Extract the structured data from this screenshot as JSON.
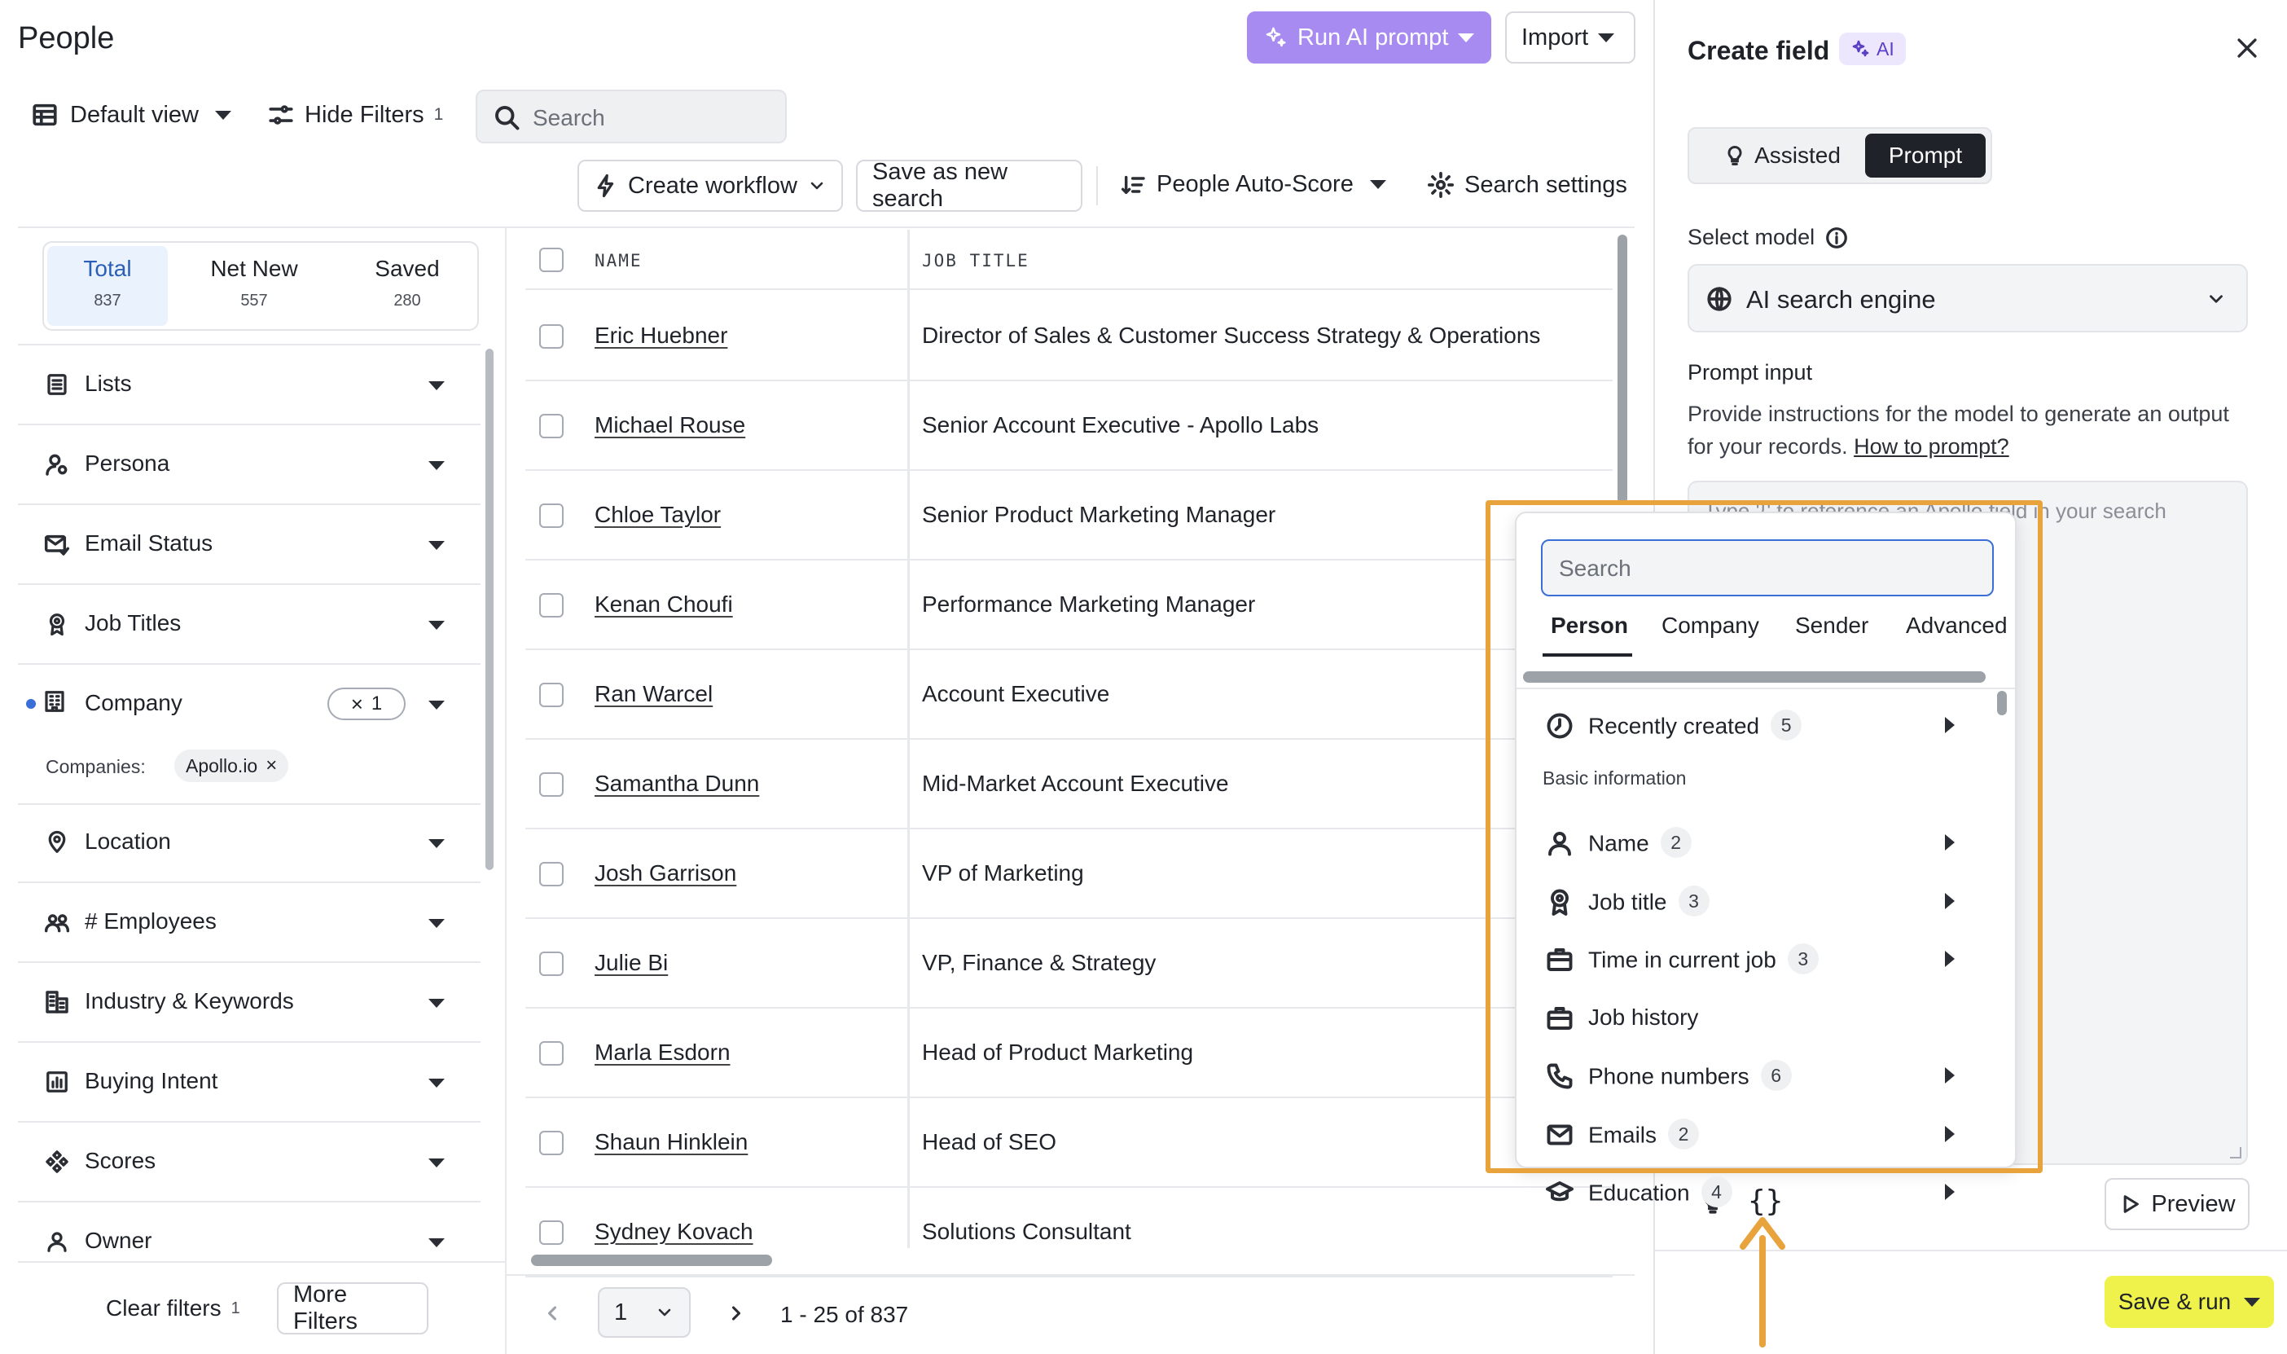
{
  "header": {
    "title": "People",
    "run_ai_label": "Run AI prompt",
    "import_label": "Import"
  },
  "toolbar": {
    "view_label": "Default view",
    "hide_filters_label": "Hide Filters",
    "hide_filters_count": "1",
    "search_placeholder": "Search",
    "create_workflow_label": "Create workflow",
    "save_search_label": "Save as new search",
    "autoscore_label": "People Auto-Score",
    "search_settings_label": "Search settings"
  },
  "stats": [
    {
      "label": "Total",
      "value": "837"
    },
    {
      "label": "Net New",
      "value": "557"
    },
    {
      "label": "Saved",
      "value": "280"
    }
  ],
  "filters": {
    "items": [
      {
        "label": "Lists",
        "icon": "list-icon"
      },
      {
        "label": "Persona",
        "icon": "persona-icon"
      },
      {
        "label": "Email Status",
        "icon": "email-status-icon"
      },
      {
        "label": "Job Titles",
        "icon": "badge-icon"
      },
      {
        "label": "Company",
        "icon": "building-icon"
      },
      {
        "label": "Location",
        "icon": "location-pin-icon"
      },
      {
        "label": "# Employees",
        "icon": "people-icon"
      },
      {
        "label": "Industry & Keywords",
        "icon": "industry-icon"
      },
      {
        "label": "Buying Intent",
        "icon": "bar-chart-icon"
      },
      {
        "label": "Scores",
        "icon": "scores-icon"
      },
      {
        "label": "Owner",
        "icon": "user-icon"
      }
    ],
    "company_count": "1",
    "companies_label": "Companies:",
    "company_chip": "Apollo.io",
    "clear_filters_label": "Clear filters",
    "clear_filters_count": "1",
    "more_filters_label": "More Filters"
  },
  "table": {
    "columns": [
      "NAME",
      "JOB TITLE"
    ],
    "rows": [
      {
        "name": "Eric Huebner",
        "job": "Director of Sales & Customer Success Strategy & Operations"
      },
      {
        "name": "Michael Rouse",
        "job": "Senior Account Executive - Apollo Labs"
      },
      {
        "name": "Chloe Taylor",
        "job": "Senior Product Marketing Manager"
      },
      {
        "name": "Kenan Choufi",
        "job": "Performance Marketing Manager"
      },
      {
        "name": "Ran Warcel",
        "job": "Account Executive"
      },
      {
        "name": "Samantha Dunn",
        "job": "Mid-Market Account Executive"
      },
      {
        "name": "Josh Garrison",
        "job": "VP of Marketing"
      },
      {
        "name": "Julie Bi",
        "job": "VP, Finance & Strategy"
      },
      {
        "name": "Marla Esdorn",
        "job": "Head of Product Marketing"
      },
      {
        "name": "Shaun Hinklein",
        "job": "Head of SEO"
      },
      {
        "name": "Sydney Kovach",
        "job": "Solutions Consultant"
      }
    ]
  },
  "pagination": {
    "page": "1",
    "range": "1 - 25 of 837"
  },
  "panel": {
    "title": "Create field",
    "ai_badge": "AI",
    "tabs": [
      "Assisted",
      "Prompt"
    ],
    "select_model_label": "Select model",
    "model_value": "AI search engine",
    "prompt_input_label": "Prompt input",
    "prompt_help": "Provide instructions for the model to generate an output for your records.",
    "how_to_link": "How to prompt?",
    "prompt_placeholder": "Type '{' to reference an Apollo field in your search",
    "preview_label": "Preview",
    "save_run_label": "Save & run"
  },
  "field_menu": {
    "search_placeholder": "Search",
    "tabs": [
      "Person",
      "Company",
      "Sender",
      "Advanced"
    ],
    "recent": {
      "label": "Recently created",
      "count": "5"
    },
    "section_label": "Basic information",
    "items": [
      {
        "label": "Name",
        "count": "2",
        "icon": "person-icon"
      },
      {
        "label": "Job title",
        "count": "3",
        "icon": "badge-icon"
      },
      {
        "label": "Time in current job",
        "count": "3",
        "icon": "briefcase-icon"
      },
      {
        "label": "Job history",
        "count": "",
        "icon": "briefcase-icon"
      },
      {
        "label": "Phone numbers",
        "count": "6",
        "icon": "phone-icon"
      },
      {
        "label": "Emails",
        "count": "2",
        "icon": "envelope-icon"
      },
      {
        "label": "Education",
        "count": "4",
        "icon": "graduation-cap-icon"
      }
    ]
  },
  "colors": {
    "highlight_orange": "#e8a33c",
    "ai_button": "#a78bf0",
    "save_run_yellow": "#eef24a",
    "active_stat_bg": "#eaf2fd",
    "prompt_tab_bg": "#1f2329"
  }
}
